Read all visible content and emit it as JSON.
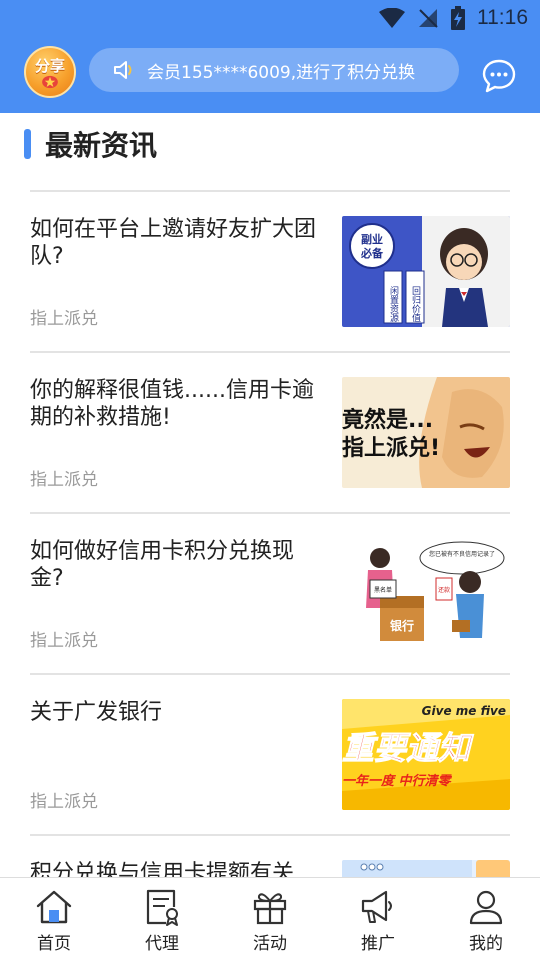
{
  "status_bar": {
    "time": "11:16"
  },
  "header": {
    "share_label": "分享",
    "notice_text": "会员155****6009,进行了积分兑换"
  },
  "section": {
    "title": "最新资讯"
  },
  "news": [
    {
      "title": "如何在平台上邀请好友扩大团队?",
      "source": "指上派兑",
      "thumb_text": [
        "副业",
        "必备",
        "闲置资源",
        "回归价值"
      ]
    },
    {
      "title": "你的解释很值钱......信用卡逾期的补救措施!",
      "source": "指上派兑",
      "thumb_text": [
        "竟然是...",
        "指上派兑!"
      ]
    },
    {
      "title": "如何做好信用卡积分兑换现金?",
      "source": "指上派兑",
      "thumb_text": [
        "黑名单",
        "还款",
        "银行",
        "您已被有不良信用记录了"
      ]
    },
    {
      "title": "关于广发银行",
      "source": "指上派兑",
      "thumb_text": [
        "Give me five",
        "重要通知",
        "一年一度 中行清零"
      ]
    },
    {
      "title": "积分兑换与信用卡提额有关",
      "source": ""
    }
  ],
  "bottom_nav": [
    {
      "label": "首页",
      "icon": "home-icon",
      "active": true
    },
    {
      "label": "代理",
      "icon": "agent-certificate-icon"
    },
    {
      "label": "活动",
      "icon": "gift-icon"
    },
    {
      "label": "推广",
      "icon": "megaphone-icon"
    },
    {
      "label": "我的",
      "icon": "user-icon"
    }
  ],
  "colors": {
    "brand": "#4a8ef3",
    "divider": "#e3e3e3",
    "source_text": "#9a9a9a"
  }
}
